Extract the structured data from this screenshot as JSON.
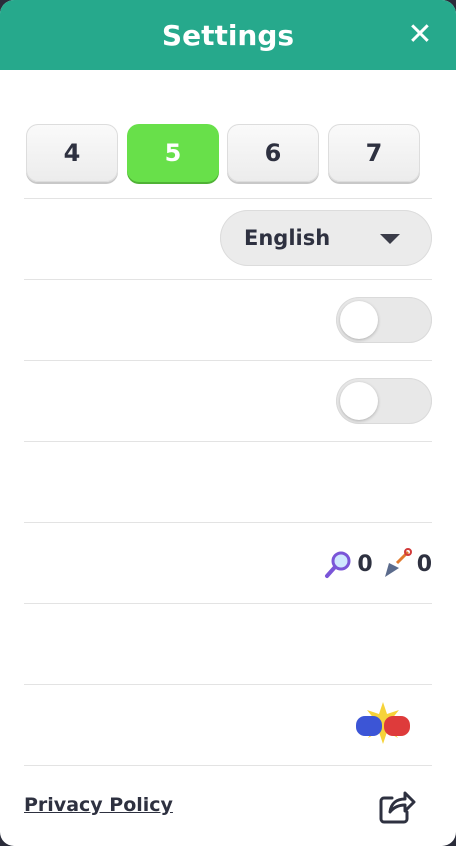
{
  "header": {
    "title": "Settings",
    "close_symbol": "✕"
  },
  "levels": {
    "options": [
      "4",
      "5",
      "6",
      "7"
    ],
    "selected": "5"
  },
  "language": {
    "selected": "English"
  },
  "toggles": [
    {
      "on": false
    },
    {
      "on": false
    }
  ],
  "powerups": {
    "magnifier_count": "0",
    "shovel_count": "0"
  },
  "footer": {
    "privacy_label": "Privacy Policy"
  },
  "icons": {
    "close": "close-icon",
    "caret": "caret-down-icon",
    "magnifier": "magnifier-icon",
    "shovel": "shovel-icon",
    "boxing": "boxing-gloves-icon",
    "share": "share-icon"
  },
  "colors": {
    "header": "#26a98c",
    "active_level": "#68e04a"
  }
}
